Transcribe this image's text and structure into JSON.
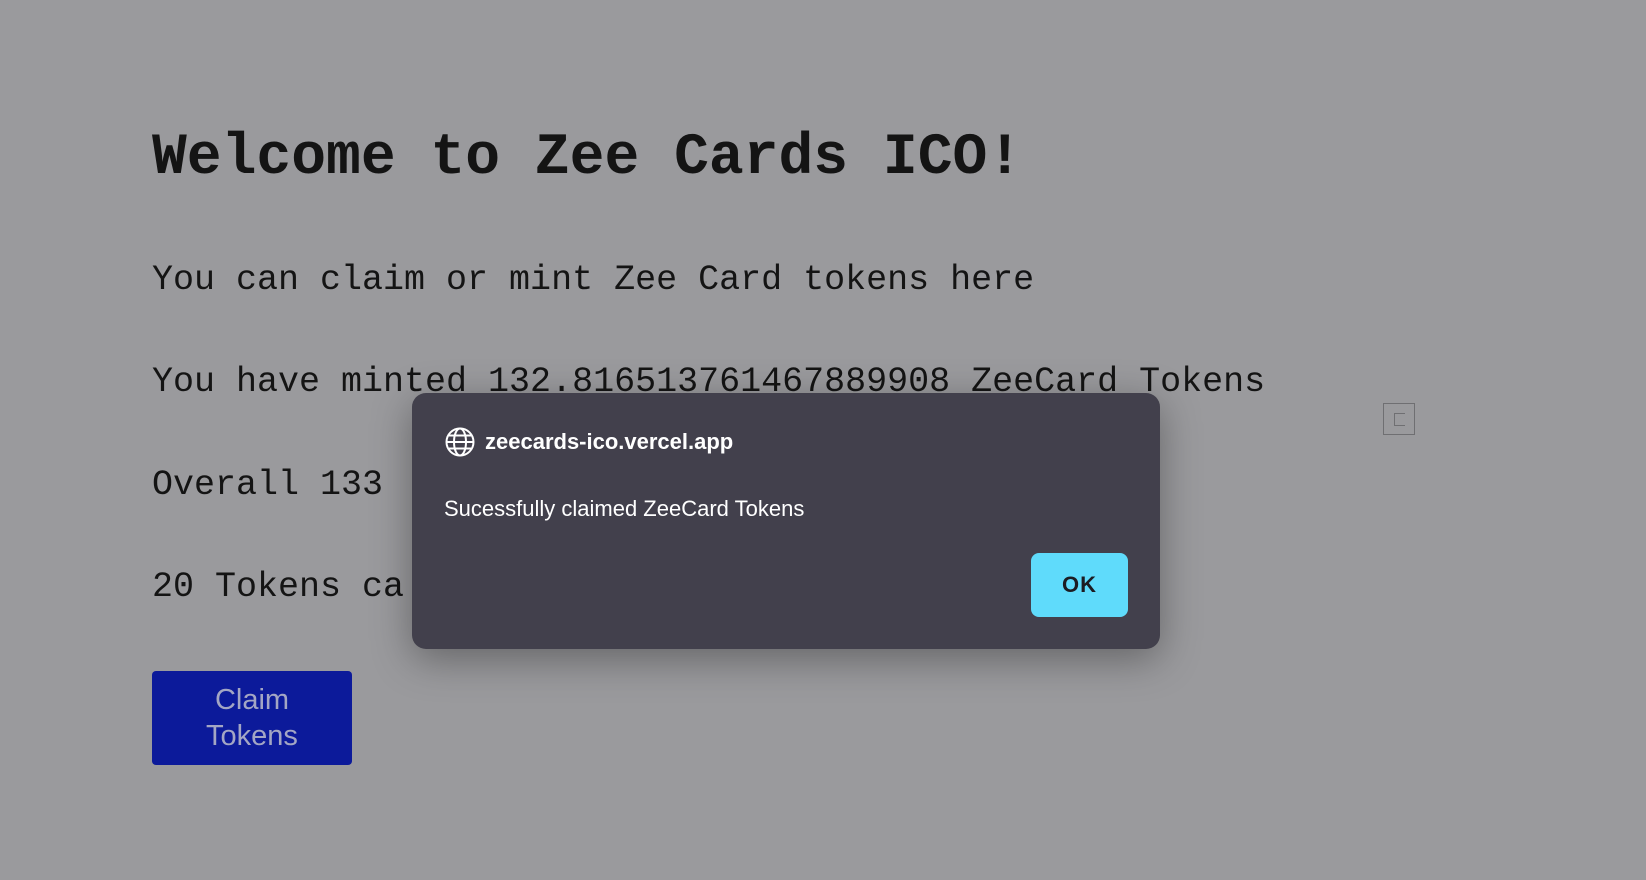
{
  "page": {
    "title": "Welcome to Zee Cards ICO!",
    "intro": "You can claim or mint Zee Card tokens here",
    "minted_text": "You have minted 132.816513761467889908 ZeeCard Tokens",
    "overall_text_visible": "Overall 133",
    "claim_text_visible": "20 Tokens ca",
    "claim_button_label": "Claim Tokens"
  },
  "dialog": {
    "origin": "zeecards-ico.vercel.app",
    "message": "Sucessfully claimed ZeeCard Tokens",
    "ok_label": "OK",
    "icon": "globe-icon"
  },
  "colors": {
    "overlay_background": "#9a9a9d",
    "dialog_background": "#42404c",
    "ok_button": "#5fdbfb",
    "claim_button": "#0c1a9a"
  }
}
